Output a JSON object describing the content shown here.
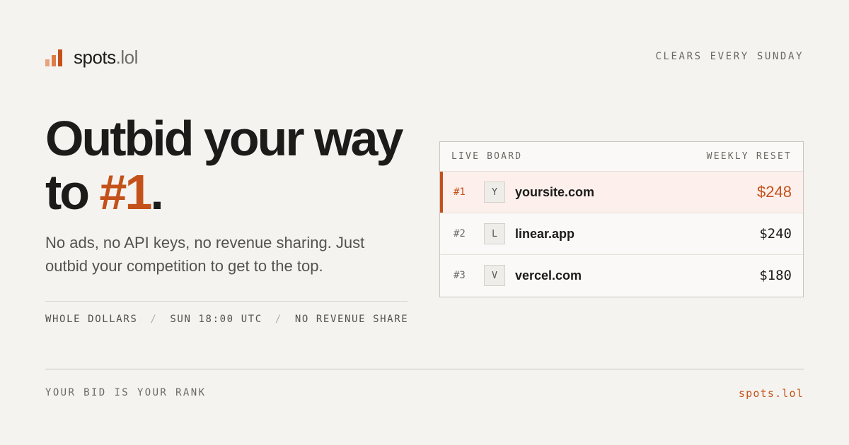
{
  "brand": {
    "name_main": "spots",
    "name_suffix": ".lol"
  },
  "header": {
    "tagline": "CLEARS EVERY SUNDAY"
  },
  "hero": {
    "headline_line1": "Outbid your way",
    "headline_line2_prefix": "to ",
    "headline_accent": "#1",
    "headline_line2_suffix": ".",
    "subtext": "No ads, no API keys, no revenue sharing. Just outbid your competition to get to the top.",
    "tags": [
      "WHOLE DOLLARS",
      "SUN 18:00 UTC",
      "NO REVENUE SHARE"
    ],
    "tag_separator": "/"
  },
  "board": {
    "title": "LIVE BOARD",
    "reset_label": "WEEKLY RESET",
    "rows": [
      {
        "rank": "#1",
        "initial": "Y",
        "site": "yoursite.com",
        "amount": "$248"
      },
      {
        "rank": "#2",
        "initial": "L",
        "site": "linear.app",
        "amount": "$240"
      },
      {
        "rank": "#3",
        "initial": "V",
        "site": "vercel.com",
        "amount": "$180"
      }
    ]
  },
  "footer": {
    "left": "YOUR BID IS YOUR RANK",
    "right": "spots.lol"
  },
  "colors": {
    "accent": "#c4511a",
    "background": "#f5f3ef",
    "text": "#1c1b19"
  },
  "icons": {
    "logo": "bar-chart-icon"
  }
}
